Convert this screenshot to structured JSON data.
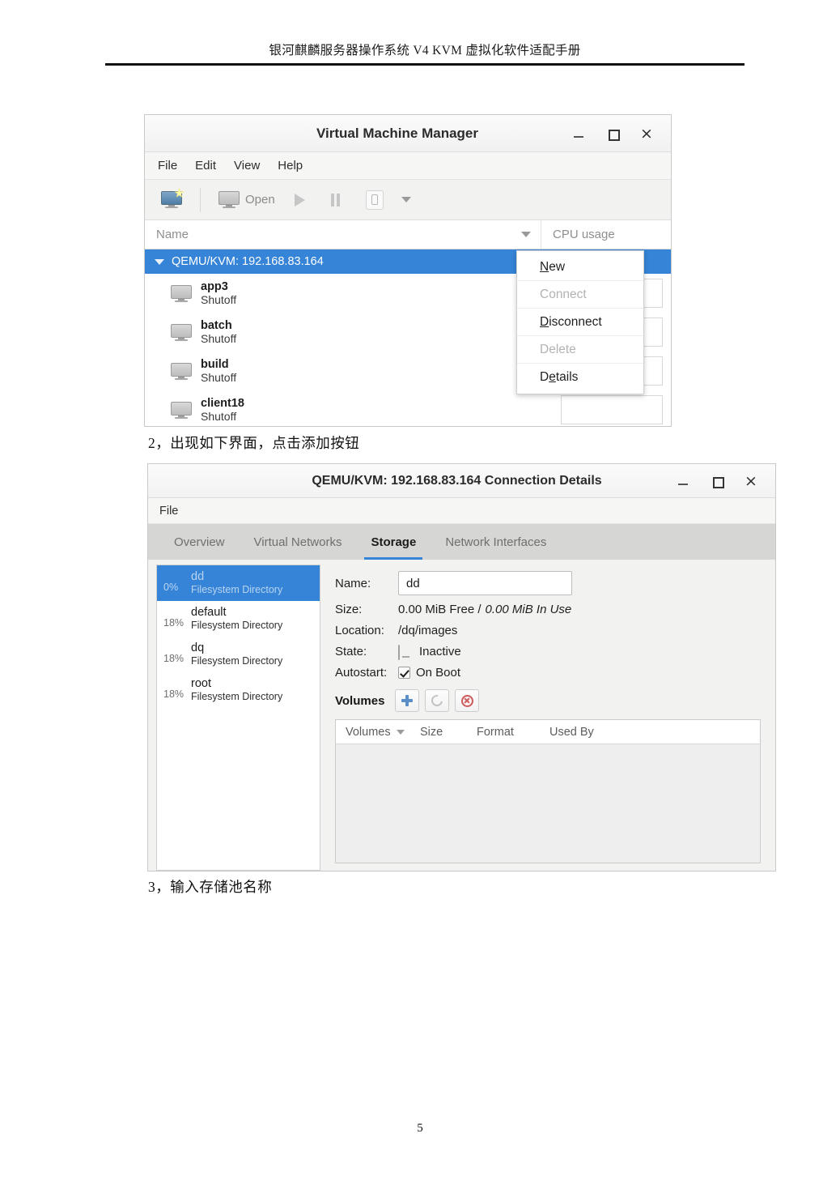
{
  "document": {
    "header_title": "银河麒麟服务器操作系统 V4 KVM 虚拟化软件适配手册",
    "page_number": "5",
    "step2_text": "2，出现如下界面，点击添加按钮",
    "step3_text": "3，输入存储池名称"
  },
  "colors": {
    "selection_blue": "#3584d8",
    "tab_underline": "#3584d8",
    "add_button_blue": "#5a8ec9",
    "delete_button_red": "#cd5b5b",
    "titlebar_bg": "#f5f5f5",
    "tabbar_bg": "#d6d6d4"
  },
  "vmm_window": {
    "title": "Virtual Machine Manager",
    "controls": {
      "minimize": "_",
      "maximize": "□",
      "close": "×"
    },
    "menubar": [
      "File",
      "Edit",
      "View",
      "Help"
    ],
    "toolbar": {
      "new_vm_icon": "new-vm-icon",
      "open_label": "Open",
      "run_icon": "play-icon",
      "pause_icon": "pause-icon",
      "shutdown_icon": "shutdown-icon",
      "shutdown_dropdown_icon": "chevron-down-icon"
    },
    "columns": {
      "name": "Name",
      "cpu": "CPU usage"
    },
    "host": {
      "label": "QEMU/KVM: 192.168.83.164",
      "expanded": true
    },
    "vms": [
      {
        "name": "app3",
        "state": "Shutoff"
      },
      {
        "name": "batch",
        "state": "Shutoff"
      },
      {
        "name": "build",
        "state": "Shutoff"
      },
      {
        "name": "client18",
        "state": "Shutoff"
      }
    ],
    "context_menu": [
      {
        "label": "New",
        "mnemonic": "N",
        "enabled": true
      },
      {
        "label": "Connect",
        "mnemonic": "",
        "enabled": false
      },
      {
        "label": "Disconnect",
        "mnemonic": "D",
        "enabled": true
      },
      {
        "label": "Delete",
        "mnemonic": "",
        "enabled": false
      },
      {
        "label": "Details",
        "mnemonic": "e",
        "enabled": true
      }
    ]
  },
  "connection_details_window": {
    "title": "QEMU/KVM: 192.168.83.164 Connection Details",
    "controls": {
      "minimize": "_",
      "maximize": "□",
      "close": "×"
    },
    "menubar": [
      "File"
    ],
    "tabs": [
      {
        "label": "Overview",
        "active": false
      },
      {
        "label": "Virtual Networks",
        "active": false
      },
      {
        "label": "Storage",
        "active": true
      },
      {
        "label": "Network Interfaces",
        "active": false
      }
    ],
    "pools": [
      {
        "percent": "0%",
        "name": "dd",
        "type": "Filesystem Directory",
        "selected": true
      },
      {
        "percent": "18%",
        "name": "default",
        "type": "Filesystem Directory",
        "selected": false
      },
      {
        "percent": "18%",
        "name": "dq",
        "type": "Filesystem Directory",
        "selected": false
      },
      {
        "percent": "18%",
        "name": "root",
        "type": "Filesystem Directory",
        "selected": false
      }
    ],
    "details": {
      "name_label": "Name:",
      "name_value": "dd",
      "size_label": "Size:",
      "size_free": "0.00 MiB Free /",
      "size_in_use": "0.00 MiB In Use",
      "location_label": "Location:",
      "location_value": "/dq/images",
      "state_label": "State:",
      "state_value": "Inactive",
      "autostart_label": "Autostart:",
      "autostart_value": "On Boot",
      "autostart_checked": true
    },
    "volumes": {
      "title": "Volumes",
      "add_icon": "plus-icon",
      "refresh_icon": "refresh-icon",
      "delete_icon": "delete-circle-icon",
      "columns": [
        "Volumes",
        "Size",
        "Format",
        "Used By"
      ],
      "rows": []
    }
  }
}
